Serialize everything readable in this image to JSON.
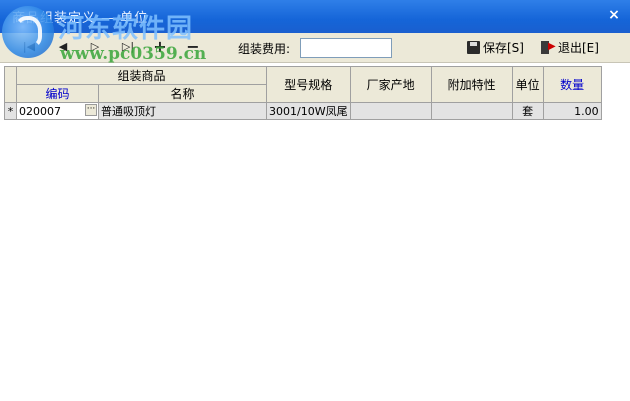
{
  "window": {
    "title": "商品组装定义 — 单位",
    "close_glyph": "×"
  },
  "watermark": {
    "site_name": "河东软件园",
    "url": "www.pc0359.cn"
  },
  "toolbar": {
    "nav_first": "|◀",
    "nav_prev": "◀",
    "nav_next": "▷",
    "nav_last": "▷|",
    "add": "+",
    "remove": "−",
    "fee_label": "组装费用:",
    "fee_value": "",
    "save_label": "保存[S]",
    "exit_label": "退出[E]"
  },
  "grid": {
    "group_header": "组装商品",
    "columns": {
      "code": "编码",
      "name": "名称",
      "model": "型号规格",
      "origin": "厂家产地",
      "extra": "附加特性",
      "unit": "单位",
      "qty": "数量"
    },
    "rows": [
      {
        "marker": "*",
        "code": "020007",
        "name": "普通吸顶灯",
        "model": "3001/10W凤尾",
        "origin": "",
        "extra": "",
        "unit": "套",
        "qty": "1.00"
      }
    ]
  },
  "colors": {
    "titlebar": "#1565d8",
    "toolbar_bg": "#ece9d8",
    "header_link_blue": "#0000cc"
  }
}
